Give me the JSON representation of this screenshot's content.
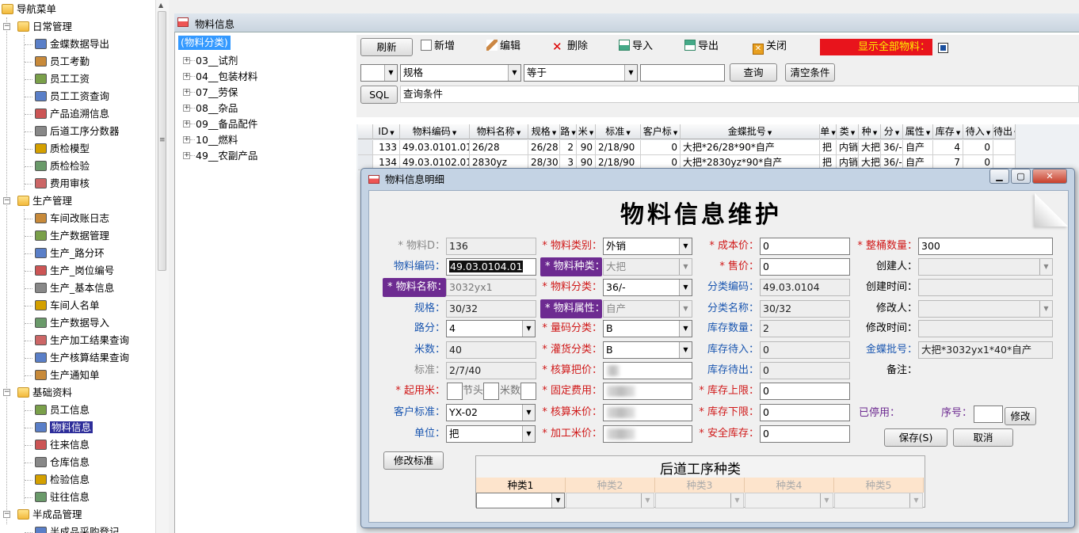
{
  "nav": {
    "root": "导航菜单",
    "groups": [
      {
        "label": "日常管理",
        "items": [
          "金蝶数据导出",
          "员工考勤",
          "员工工资",
          "员工工资查询",
          "产品追溯信息",
          "后道工序分数器",
          "质检模型",
          "质检检验",
          "费用审核"
        ]
      },
      {
        "label": "生产管理",
        "items": [
          "车间改账日志",
          "生产数据管理",
          "生产_路分环",
          "生产_岗位编号",
          "生产_基本信息",
          "车间人名单",
          "生产数据导入",
          "生产加工结果查询",
          "生产核算结果查询",
          "生产通知单"
        ]
      },
      {
        "label": "基础资料",
        "items": [
          "员工信息",
          "物料信息",
          "往来信息",
          "仓库信息",
          "检验信息",
          "驻往信息"
        ]
      },
      {
        "label": "半成品管理",
        "items": [
          "半成品采购登记"
        ]
      }
    ],
    "selected": "物料信息"
  },
  "window": {
    "title": "物料信息"
  },
  "category_tree": {
    "root": "(物料分类)",
    "items": [
      "03__试剂",
      "04__包装材料",
      "07__劳保",
      "08__杂品",
      "09__备品配件",
      "10__燃料",
      "49__农副产品"
    ]
  },
  "toolbar": {
    "refresh": "刷新",
    "add": "新增",
    "edit": "编辑",
    "delete": "删除",
    "import": "导入",
    "export": "导出",
    "close": "关闭",
    "show_all": "显示全部物料："
  },
  "query": {
    "field": "规格",
    "operator": "等于",
    "value": "",
    "query_btn": "查询",
    "clear_btn": "清空条件",
    "sql_btn": "SQL",
    "sql_label": "查询条件"
  },
  "grid": {
    "headers": [
      "ID",
      "物料编码",
      "物料名称",
      "规格",
      "路",
      "米",
      "标准",
      "客户标",
      "金蝶批号",
      "单",
      "类",
      "种",
      "分",
      "属性",
      "库存",
      "待入",
      "待出"
    ],
    "rows": [
      [
        "133",
        "49.03.0101.01",
        "26/28",
        "26/28",
        "2",
        "90",
        "2/18/90",
        "0",
        "大把*26/28*90*自产",
        "把",
        "内销",
        "大把",
        "36/-",
        "自产",
        "4",
        "0",
        ""
      ],
      [
        "134",
        "49.03.0102.01",
        "2830yz",
        "28/30",
        "3",
        "90",
        "2/18/90",
        "0",
        "大把*2830yz*90*自产",
        "把",
        "内销",
        "大把",
        "36/-",
        "自产",
        "7",
        "0",
        ""
      ]
    ]
  },
  "dialog": {
    "title": "物料信息明细",
    "heading": "物料信息维护",
    "labels": {
      "id": "* 物料D：",
      "code": "物料编码：",
      "name": "* 物料名称：",
      "spec": "规格：",
      "lu": "路分：",
      "mi": "米数：",
      "std": "标准：",
      "qiyong": "* 起用米：",
      "jietou": "节头",
      "mishu": "米数",
      "cust_std": "客户标准：",
      "unit": "单位：",
      "mat_type": "* 物料类别：",
      "mat_kind": "* 物料种类：",
      "mat_class": "* 物料分类：",
      "mat_attr": "* 物料属性：",
      "liang": "* 量码分类：",
      "guan": "* 灌货分类：",
      "hesuan": "* 核算把价：",
      "gudingfei": "* 固定费用：",
      "hesuanmi": "* 核算米价：",
      "jiagong": "* 加工米价：",
      "cost": "* 成本价：",
      "price": "* 售价：",
      "class_code": "分类编码：",
      "class_name": "分类名称：",
      "stock": "库存数量：",
      "pending_in": "库存待入：",
      "pending_out": "库存待出：",
      "upper": "* 库存上限：",
      "lower": "* 库存下限：",
      "safety": "* 安全库存：",
      "full_qty": "* 整桶数量：",
      "creator": "创建人：",
      "create_time": "创建时间：",
      "modifier": "修改人：",
      "modify_time": "修改时间：",
      "batch": "金蝶批号：",
      "remark": "备注：",
      "disabled": "已停用：",
      "seq": "序号："
    },
    "values": {
      "id": "136",
      "code": "49.03.0104.01",
      "name": "3032yx1",
      "spec": "30/32",
      "lu": "4",
      "mi": "40",
      "std": "2/7/40",
      "cust_std": "YX-02",
      "unit": "把",
      "mat_type": "外销",
      "mat_kind": "大把",
      "mat_class": "36/-",
      "mat_attr": "自产",
      "liang": "B",
      "guan": "B",
      "cost": "0",
      "price": "0",
      "class_code": "49.03.0104",
      "class_name": "30/32",
      "stock": "2",
      "pending_in": "0",
      "pending_out": "0",
      "upper": "0",
      "lower": "0",
      "safety": "0",
      "full_qty": "300",
      "batch": "大把*3032yx1*40*自产"
    },
    "buttons": {
      "modify_seq": "修改",
      "save": "保存(S)",
      "cancel": "取消",
      "modify_std": "修改标准"
    },
    "process": {
      "title": "后道工序种类",
      "cols": [
        "种类1",
        "种类2",
        "种类3",
        "种类4",
        "种类5"
      ]
    }
  }
}
